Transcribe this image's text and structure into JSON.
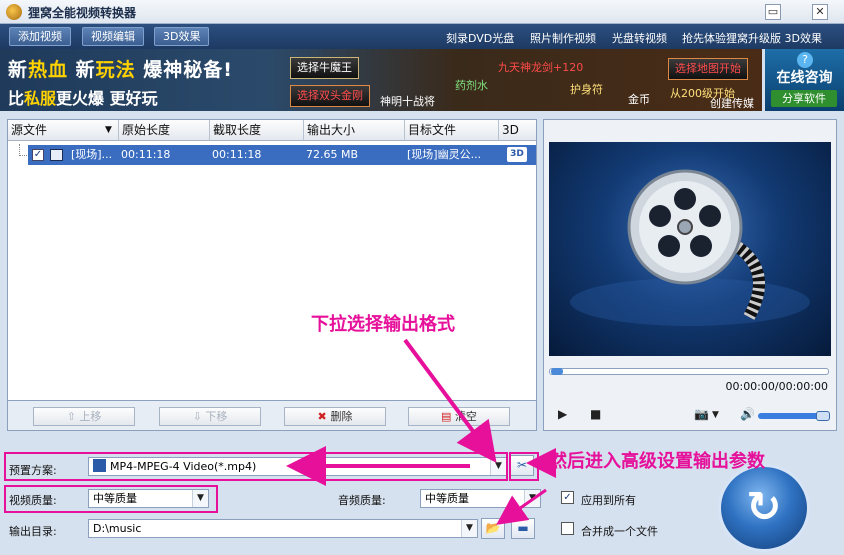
{
  "window": {
    "title": "狸窝全能视频转换器",
    "minimize": "▭",
    "close": "✕"
  },
  "toolbar": {
    "add_video": "添加视频",
    "edit_video": "视频编辑",
    "effect_3d": "3D效果",
    "links": [
      "刻录DVD光盘",
      "照片制作视频",
      "光盘转视频",
      "抢先体验狸窝升级版 3D效果"
    ]
  },
  "banner": {
    "line1_a": "新",
    "line1_b": "热血",
    "line1_c": " 新",
    "line1_d": "玩法",
    "line1_e": " 爆神秘备!",
    "line2_a": "比",
    "line2_b": "私服",
    "line2_c": "更火爆 更好玩",
    "btn_niumowang": "选择牛魔王",
    "btn_shuangtou": "选择双头金刚",
    "t_shenming": "神明十战将",
    "t_yaoji": "药剂水",
    "t_jiutian": "九天神龙剑+120",
    "t_hushen": "护身符",
    "t_jinbi": "金币",
    "btn_map": "选择地图开始",
    "t_cong": "从200级开始",
    "t_chuangzhi": "创建传媒"
  },
  "consult": {
    "q": "?",
    "title": "在线咨询",
    "share": "分享软件"
  },
  "file_list": {
    "columns": [
      "源文件",
      "原始长度",
      "截取长度",
      "输出大小",
      "目标文件",
      "3D"
    ],
    "rows": [
      {
        "checked": "✓",
        "source": "[现场]...",
        "original_length": "00:11:18",
        "clip_length": "00:11:18",
        "output_size": "72.65 MB",
        "target": "[现场]幽灵公...",
        "badge": "3D"
      }
    ]
  },
  "list_actions": {
    "move_up": "上移",
    "move_down": "下移",
    "delete": "删除",
    "clear": "清空"
  },
  "preview": {
    "time": "00:00:00/00:00:00"
  },
  "settings": {
    "preset_label": "预置方案:",
    "preset_value": "MP4-MPEG-4 Video(*.mp4)",
    "video_quality_label": "视频质量:",
    "video_quality_value": "中等质量",
    "audio_quality_label": "音频质量:",
    "audio_quality_value": "中等质量",
    "apply_all_label": "应用到所有",
    "apply_all_checked": "✓",
    "output_dir_label": "输出目录:",
    "output_dir_value": "D:\\music",
    "merge_label": "合并成一个文件"
  },
  "annotations": {
    "dropdown_hint": "下拉选择输出格式",
    "advanced_hint": "然后进入高级设置输出参数"
  },
  "colors": {
    "accent": "#e6109a",
    "selection": "#3a6cc0"
  }
}
